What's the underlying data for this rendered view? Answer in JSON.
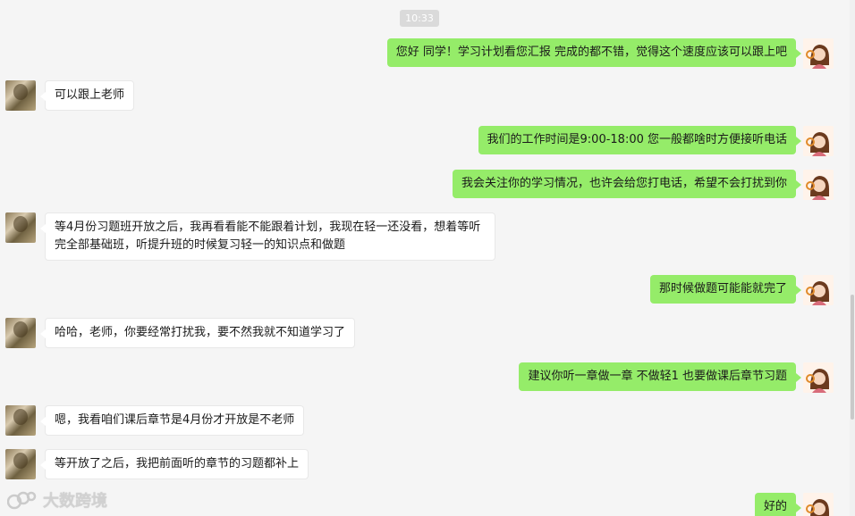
{
  "timestamp": "10:33",
  "colors": {
    "background": "#f5f5f5",
    "outgoing_bubble": "#95ec69",
    "incoming_bubble": "#ffffff"
  },
  "messages": [
    {
      "side": "out",
      "text": "您好 同学！学习计划看您汇报 完成的都不错，觉得这个速度应该可以跟上吧"
    },
    {
      "side": "in",
      "text": "可以跟上老师"
    },
    {
      "side": "out",
      "text": "我们的工作时间是9:00-18:00 您一般都啥时方便接听电话"
    },
    {
      "side": "out",
      "text": "我会关注你的学习情况，也许会给您打电话，希望不会打扰到你"
    },
    {
      "side": "in",
      "text": "等4月份习题班开放之后，我再看看能不能跟着计划，我现在轻一还没看，想着等听完全部基础班，听提升班的时候复习轻一的知识点和做题"
    },
    {
      "side": "out",
      "text": "那时候做题可能能就完了"
    },
    {
      "side": "in",
      "text": "哈哈，老师，你要经常打扰我，要不然我就不知道学习了"
    },
    {
      "side": "out",
      "text": "建议你听一章做一章 不做轻1 也要做课后章节习题"
    },
    {
      "side": "in",
      "text": "嗯，我看咱们课后章节是4月份才开放是不老师"
    },
    {
      "side": "in",
      "text": "等开放了之后，我把前面听的章节的习题都补上"
    },
    {
      "side": "out",
      "text": "好的"
    }
  ],
  "watermark": {
    "text": "大数跨境",
    "icon": "logo-icon"
  }
}
